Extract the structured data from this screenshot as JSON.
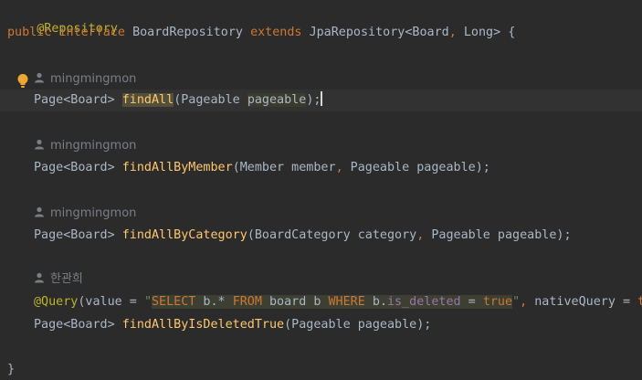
{
  "code": {
    "annotation_line": "@Repository",
    "decl": {
      "kw_public": "public",
      "kw_interface": "interface",
      "name": "BoardRepository",
      "kw_extends": "extends",
      "parent": "JpaRepository<Board",
      "comma": ",",
      "parent_rest": " Long> {"
    },
    "method1": {
      "author": "mingmingmon",
      "type": "Page<Board> ",
      "name": "findAll",
      "open": "(Pageable ",
      "param": "pageable",
      "close": ");"
    },
    "method2": {
      "author": "mingmingmon",
      "type": "Page<Board> ",
      "name": "findAllByMember",
      "args1": "(Member member",
      "comma": ",",
      "args2": " Pageable pageable);"
    },
    "method3": {
      "author": "mingmingmon",
      "type": "Page<Board> ",
      "name": "findAllByCategory",
      "args1": "(BoardCategory category",
      "comma": ",",
      "args2": " Pageable pageable);"
    },
    "method4": {
      "author": "한관희",
      "query_ann": "@Query",
      "query_open": "(value = ",
      "quote_open": "\"",
      "sql_select": "SELECT",
      "sql_part1": " b.* ",
      "sql_from": "FROM",
      "sql_part2": " board b ",
      "sql_where": "WHERE",
      "sql_part3": " b.",
      "sql_col": "is_deleted",
      "sql_part4": " = ",
      "sql_true": "true",
      "quote_close": "\"",
      "comma": ",",
      "native": " nativeQuery = ",
      "native_val": "true",
      "query_close": ")",
      "type": "Page<Board> ",
      "name": "findAllByIsDeletedTrue",
      "args": "(Pageable pageable);"
    },
    "closing_brace": "}"
  },
  "colors": {
    "background": "#2b2b2b",
    "keyword": "#cc7832",
    "annotation": "#bbb529",
    "method": "#ffc66d",
    "text": "#a9b7c6",
    "hint": "#7a7e85"
  },
  "icons": [
    "lightbulb-icon",
    "user-icon"
  ]
}
